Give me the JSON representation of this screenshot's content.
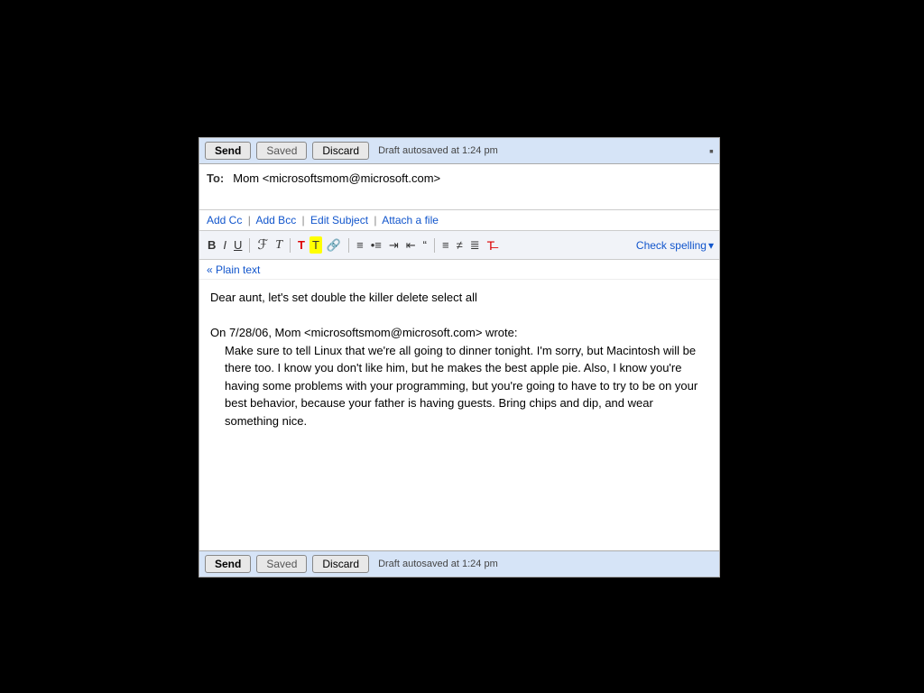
{
  "window": {
    "top_bar": {
      "send_label": "Send",
      "saved_label": "Saved",
      "discard_label": "Discard",
      "draft_status": "Draft autosaved at 1:24 pm"
    },
    "to_field": {
      "label": "To:",
      "value": "Mom <microsoftsmom@microsoft.com>"
    },
    "links": {
      "add_cc": "Add Cc",
      "add_bcc": "Add Bcc",
      "edit_subject": "Edit Subject",
      "attach_file": "Attach a file"
    },
    "toolbar": {
      "bold": "B",
      "italic": "I",
      "underline": "U",
      "font_family": "𝓕",
      "font_size": "𝑇",
      "text_color": "T",
      "bg_color": "T",
      "link": "🔗",
      "numbered_list": "≡",
      "bulleted_list": "≡",
      "indent_more": "⇥",
      "indent_less": "⇤",
      "quote": "❝",
      "align_left": "≡",
      "align_center": "≡",
      "align_right": "≡",
      "remove_format": "T",
      "check_spelling": "Check spelling"
    },
    "plain_text_link": "« Plain text",
    "body": {
      "first_line": "Dear aunt, let's set double the killer delete select all",
      "quoted_header": "On 7/28/06, Mom <microsoftsmom@microsoft.com> wrote:",
      "quoted_body": "Make sure to tell Linux that we're all going to dinner tonight. I'm sorry, but Macintosh will be there too. I know you don't like him, but he makes the best apple pie. Also, I know you're having some problems with your programming, but you're going to have to try to be on your best behavior, because your father is having guests. Bring chips and dip, and wear something nice."
    },
    "bottom_bar": {
      "send_label": "Send",
      "saved_label": "Saved",
      "discard_label": "Discard",
      "draft_status": "Draft autosaved at 1:24 pm"
    }
  }
}
